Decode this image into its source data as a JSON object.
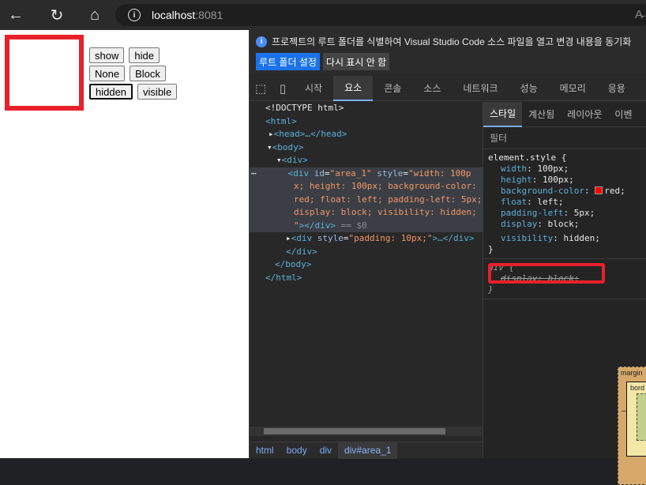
{
  "browser": {
    "host": "localhost",
    "port": ":8081",
    "reader_label": "A̵"
  },
  "page": {
    "buttons_row1": [
      "show",
      "hide"
    ],
    "buttons_row2": [
      "None",
      "Block"
    ],
    "buttons_row3": [
      "hidden",
      "visible"
    ]
  },
  "devtools": {
    "infobar_text": "프로젝트의 루트 폴더를 식별하여 Visual Studio Code 소스 파일을 열고 변경 내용을 동기화",
    "infobar_btn_primary": "루트 폴더 설정",
    "infobar_btn_secondary": "다시 표시 안 함",
    "tabs": [
      "시작",
      "요소",
      "콘솔",
      "소스",
      "네트워크",
      "성능",
      "메모리",
      "응용"
    ],
    "active_tab": "요소",
    "style_tabs": [
      "스타일",
      "계산됨",
      "레이아웃",
      "이벤"
    ],
    "filter_placeholder": "필터",
    "crumbs": [
      "html",
      "body",
      "div",
      "div#area_1"
    ],
    "dom": {
      "doctype": "<!DOCTYPE html>",
      "html_open": "<html>",
      "head": "<head>…</head>",
      "body_open": "<body>",
      "div_open": "<div>",
      "sel_line1a": "<div ",
      "sel_attr1": "id",
      "sel_val1": "\"area_1\"",
      "sel_attr2": "style",
      "sel_val2a": "\"width: 100p",
      "sel_val2b": "x; height: 100px; background-color:",
      "sel_val2c": "red; float: left; padding-left: 5px;",
      "sel_val2d": "display: block; visibility: hidden;",
      "sel_val2e": "\"",
      "sel_close": "></div>",
      "sel_eq": "== $0",
      "div2_open": "<div ",
      "div2_attr": "style",
      "div2_val": "\"padding: 10px;\"",
      "div2_rest": ">…</div>",
      "div_close": "</div>",
      "body_close": "</body>",
      "html_close": "</html>"
    },
    "element_style": {
      "selector": "element.style {",
      "props": [
        {
          "name": "width",
          "value": "100px;"
        },
        {
          "name": "height",
          "value": "100px;"
        },
        {
          "name": "background-color",
          "value": "red;"
        },
        {
          "name": "float",
          "value": "left;"
        },
        {
          "name": "padding-left",
          "value": "5px;"
        },
        {
          "name": "display",
          "value": "block;"
        },
        {
          "name": "visibility",
          "value": "hidden;"
        }
      ],
      "close": "}"
    },
    "div_rule": {
      "selector": "div {",
      "prop": "display: block;",
      "close": "}"
    },
    "box_model": {
      "margin": "margin",
      "border": "bord",
      "dash": "–"
    }
  },
  "colors": {
    "highlight_red": "#e8202a",
    "accent_blue": "#1a73e8"
  }
}
